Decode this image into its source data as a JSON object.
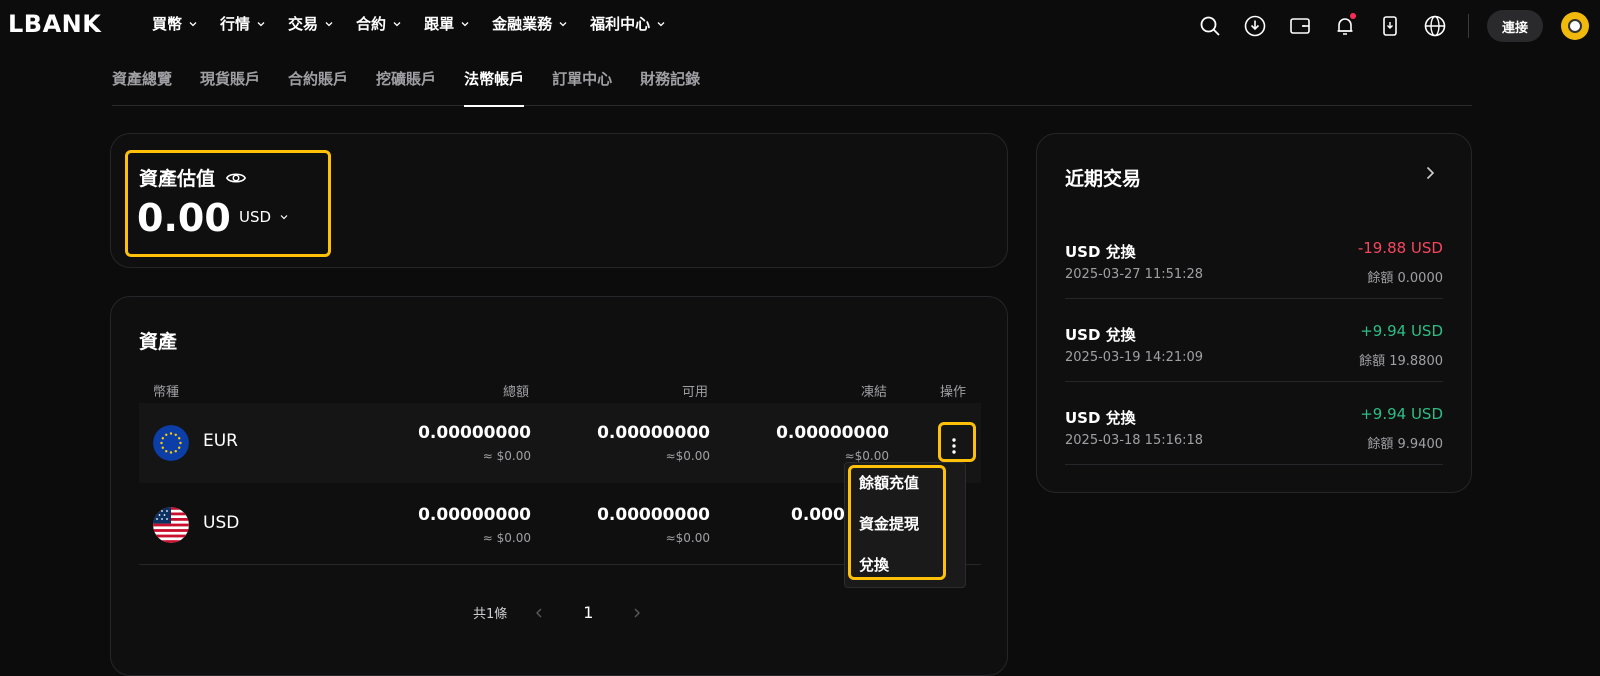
{
  "brand": {
    "logo": "LBANK"
  },
  "nav": {
    "items": [
      {
        "label": "買幣"
      },
      {
        "label": "行情"
      },
      {
        "label": "交易"
      },
      {
        "label": "合約"
      },
      {
        "label": "跟單"
      },
      {
        "label": "金融業務"
      },
      {
        "label": "福利中心"
      }
    ],
    "login_label": "連接",
    "icons": [
      "search-icon",
      "download-icon",
      "wallet-icon",
      "bell-icon",
      "app-icon",
      "globe-icon"
    ]
  },
  "tabs": [
    {
      "label": "資產總覽"
    },
    {
      "label": "現貨賬戶"
    },
    {
      "label": "合約賬戶"
    },
    {
      "label": "挖礦賬戶"
    },
    {
      "label": "法幣帳戶",
      "active": true
    },
    {
      "label": "訂單中心"
    },
    {
      "label": "財務記錄"
    }
  ],
  "valuation": {
    "title": "資產估值",
    "amount": "0.00",
    "currency": "USD"
  },
  "assets": {
    "title": "資產",
    "columns": {
      "currency": "幣種",
      "total": "總額",
      "available": "可用",
      "frozen": "凍結",
      "action": "操作"
    },
    "rows": [
      {
        "code": "EUR",
        "total": "0.00000000",
        "total_usd": "≈ $0.00",
        "available": "0.00000000",
        "available_usd": "≈$0.00",
        "frozen": "0.00000000",
        "frozen_usd": "≈$0.00"
      },
      {
        "code": "USD",
        "total": "0.00000000",
        "total_usd": "≈ $0.00",
        "available": "0.00000000",
        "available_usd": "≈$0.00",
        "frozen": "0.0000",
        "frozen_usd": ""
      }
    ],
    "menu": {
      "deposit": "餘額充值",
      "withdraw": "資金提現",
      "convert": "兌換"
    },
    "pager": {
      "total": "共1條",
      "page": "1"
    }
  },
  "recent": {
    "title": "近期交易",
    "items": [
      {
        "name": "USD 兌換",
        "time": "2025-03-27 11:51:28",
        "amount": "-19.88 USD",
        "direction": "neg",
        "balance": "餘額 0.0000"
      },
      {
        "name": "USD 兌換",
        "time": "2025-03-19 14:21:09",
        "amount": "+9.94 USD",
        "direction": "pos",
        "balance": "餘額 19.8800"
      },
      {
        "name": "USD 兌換",
        "time": "2025-03-18 15:16:18",
        "amount": "+9.94 USD",
        "direction": "pos",
        "balance": "餘額 9.9400"
      }
    ]
  },
  "colors": {
    "highlight": "#ffc107",
    "negative": "#f6465d",
    "positive": "#2ebd85",
    "background": "#0c0c0d"
  }
}
